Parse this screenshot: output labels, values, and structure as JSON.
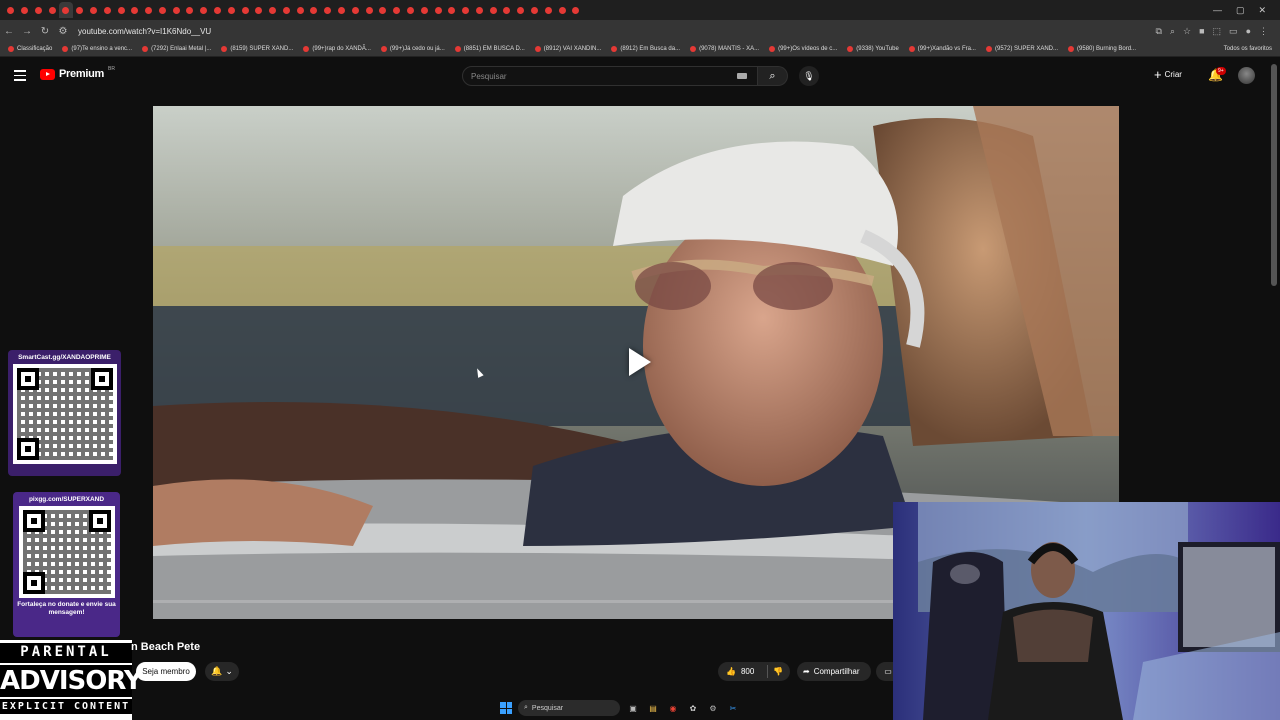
{
  "browser": {
    "tab_count": 42,
    "url": "youtube.com/watch?v=I1K6Ndo__VU",
    "win_ctrls": [
      "—",
      "▢",
      "✕"
    ],
    "bookmarks": [
      "Classificação",
      "(97)Te ensino a venc...",
      "(7292) Enlaai Metal |...",
      "(8159) SUPER XAND...",
      "(99+)rap do XANDÃ...",
      "(99+)Já cedo ou já...",
      "(8851) EM BUSCA D...",
      "(8912) VAI XANDIN...",
      "(8912) Em Busca da...",
      "(9078) MANTIS - XA...",
      "(99+)Os vídeos de c...",
      "(9338) YouTube",
      "(99+)Xandão vs Fra...",
      "(9572) SUPER XAND...",
      "(9580) Burning Bord..."
    ],
    "bookmarks_right": "Todos os favoritos"
  },
  "youtube": {
    "brand": "Premium",
    "region": "BR",
    "search_placeholder": "Pesquisar",
    "create_label": "Criar",
    "notif_badge": "9+"
  },
  "video": {
    "title": "n Beach Pete",
    "progress": 0
  },
  "actions": {
    "member_label": "Seja membro",
    "like_count": "800",
    "share_label": "Compartilhar"
  },
  "overlay": {
    "qr1_title": "SmartCast.gg/XANDAOPRIME",
    "qr2_title": "pixgg.com/SUPERXAND",
    "qr2_footer": "Fortaleça no donate e envie sua mensagem!",
    "advisory_1": "PARENTAL",
    "advisory_2": "ADVISORY",
    "advisory_3": "EXPLICIT CONTENT"
  },
  "taskbar": {
    "search_label": "Pesquisar"
  },
  "colors": {
    "bg": "#0f0f0f",
    "youtube_red": "#ff0000",
    "qr_purple": "#4a2888"
  }
}
